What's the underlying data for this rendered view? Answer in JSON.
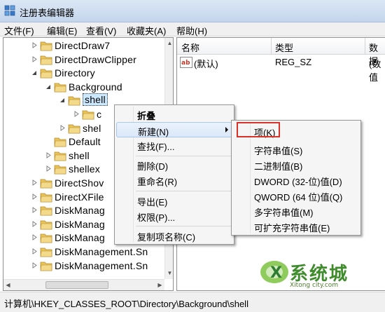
{
  "window": {
    "title": "注册表编辑器"
  },
  "menubar": [
    "文件(F)",
    "编辑(E)",
    "查看(V)",
    "收藏夹(A)",
    "帮助(H)"
  ],
  "tree": {
    "items": [
      {
        "label": "DirectDraw7",
        "expander": "collapsed"
      },
      {
        "label": "DirectDrawClipper",
        "expander": "collapsed"
      },
      {
        "label": "Directory",
        "expander": "expanded"
      },
      {
        "label": "Background",
        "expander": "expanded"
      },
      {
        "label": "shell",
        "expander": "expanded",
        "selected": true
      },
      {
        "label": "c",
        "expander": "collapsed"
      },
      {
        "label": "shel",
        "expander": "collapsed"
      },
      {
        "label": "Default",
        "expander": "none"
      },
      {
        "label": "shell",
        "expander": "collapsed"
      },
      {
        "label": "shellex",
        "expander": "collapsed"
      },
      {
        "label": "DirectShov",
        "expander": "collapsed"
      },
      {
        "label": "DirectXFile",
        "expander": "collapsed"
      },
      {
        "label": "DiskManag",
        "expander": "collapsed"
      },
      {
        "label": "DiskManag",
        "expander": "collapsed"
      },
      {
        "label": "DiskManag",
        "expander": "collapsed"
      },
      {
        "label": "DiskManagement.Sn",
        "expander": "collapsed"
      },
      {
        "label": "DiskManagement.Sn",
        "expander": "collapsed"
      }
    ]
  },
  "list": {
    "columns": [
      "名称",
      "类型",
      "数据"
    ],
    "rows": [
      {
        "name": "(默认)",
        "type": "REG_SZ",
        "data": "(数值"
      }
    ]
  },
  "context_menu": {
    "items": [
      {
        "label": "折叠",
        "bold": true
      },
      {
        "label": "新建(N)",
        "highlighted": true,
        "submenu": true
      },
      {
        "label": "查找(F)..."
      },
      {
        "separator": true
      },
      {
        "label": "删除(D)"
      },
      {
        "label": "重命名(R)"
      },
      {
        "separator": true
      },
      {
        "label": "导出(E)"
      },
      {
        "label": "权限(P)..."
      },
      {
        "separator": true
      },
      {
        "label": "复制项名称(C)"
      }
    ]
  },
  "submenu": {
    "items": [
      "项(K)",
      "字符串值(S)",
      "二进制值(B)",
      "DWORD (32-位)值(D)",
      "QWORD (64 位)值(Q)",
      "多字符串值(M)",
      "可扩充字符串值(E)"
    ]
  },
  "statusbar": {
    "path": "计算机\\HKEY_CLASSES_ROOT\\Directory\\Background\\shell"
  },
  "watermark": {
    "text": "系统城",
    "url": "Xitong city.com"
  },
  "colors": {
    "highlight_box": "#d9322b",
    "selection": "#cce8ff",
    "folder": "#e8c35a"
  }
}
